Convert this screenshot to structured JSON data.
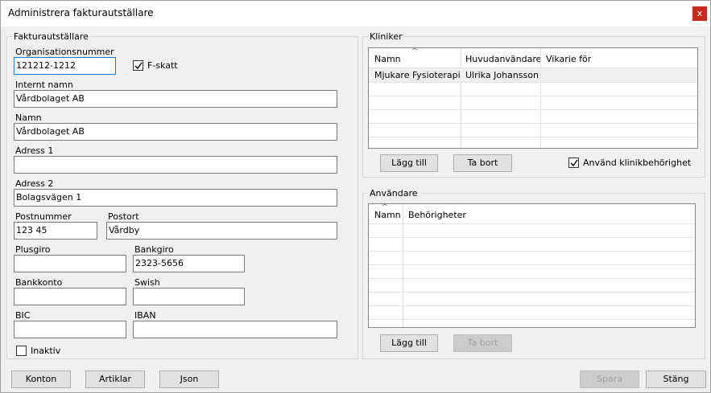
{
  "window": {
    "title": "Administrera fakturautställare",
    "close_label": "x"
  },
  "issuer": {
    "group_title": "Fakturautställare",
    "org_number_label": "Organisationsnummer",
    "org_number_value": "121212-1212",
    "fskatt_label": "F-skatt",
    "fskatt_checked": true,
    "internal_name_label": "Internt namn",
    "internal_name_value": "Vårdbolaget AB",
    "name_label": "Namn",
    "name_value": "Vårdbolaget AB",
    "address1_label": "Adress 1",
    "address1_value": "",
    "address2_label": "Adress 2",
    "address2_value": "Bolagsvägen 1",
    "postal_code_label": "Postnummer",
    "postal_code_value": "123 45",
    "city_label": "Postort",
    "city_value": "Vårdby",
    "plusgiro_label": "Plusgiro",
    "plusgiro_value": "",
    "bankgiro_label": "Bankgiro",
    "bankgiro_value": "2323-5656",
    "bank_account_label": "Bankkonto",
    "bank_account_value": "",
    "swish_label": "Swish",
    "swish_value": "",
    "bic_label": "BIC",
    "bic_value": "",
    "iban_label": "IBAN",
    "iban_value": "",
    "inactive_label": "Inaktiv",
    "inactive_checked": false
  },
  "clinics": {
    "group_title": "Kliniker",
    "columns": [
      "Namn",
      "Huvudanvändare",
      "Vikarie för"
    ],
    "rows": [
      [
        "Mjukare Fysioterapi",
        "Ulrika Johansson",
        ""
      ]
    ],
    "add_label": "Lägg till",
    "remove_label": "Ta bort",
    "use_permission_label": "Använd klinikbehörighet",
    "use_permission_checked": true
  },
  "users": {
    "group_title": "Användare",
    "columns": [
      "Namn",
      "Behörigheter"
    ],
    "add_label": "Lägg till",
    "remove_label": "Ta bort"
  },
  "footer": {
    "accounts_label": "Konton",
    "articles_label": "Artiklar",
    "json_label": "Json",
    "save_label": "Spara",
    "close_label": "Stäng"
  }
}
